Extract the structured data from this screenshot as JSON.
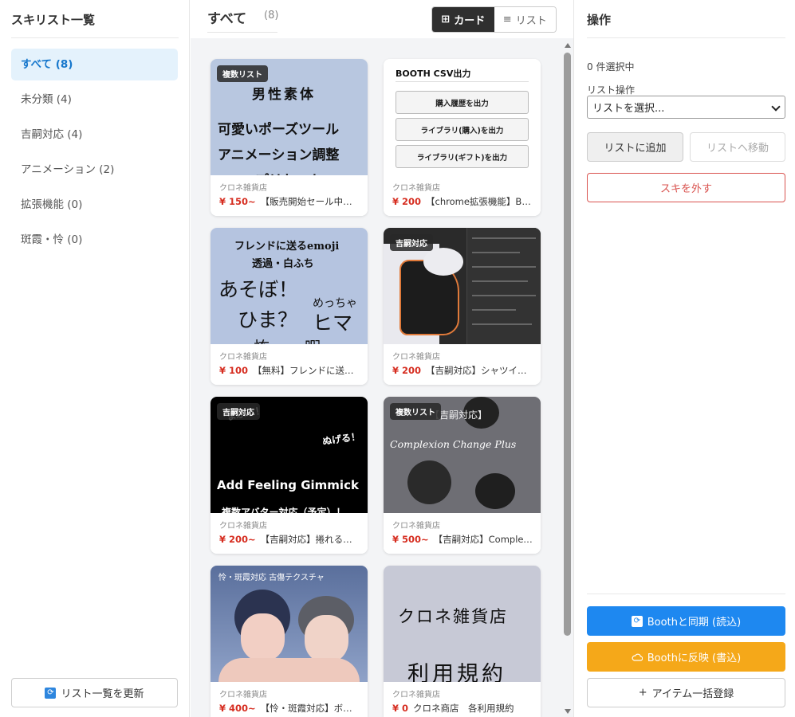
{
  "sidebar": {
    "title": "スキリスト一覧",
    "items": [
      {
        "label": "すべて (8)",
        "active": true
      },
      {
        "label": "未分類 (4)"
      },
      {
        "label": "吉嗣対応 (4)"
      },
      {
        "label": "アニメーション (2)"
      },
      {
        "label": "拡張機能 (0)"
      },
      {
        "label": "斑霞・怜 (0)"
      }
    ],
    "refresh_label": "リスト一覧を更新",
    "refresh_icon": "sync-icon"
  },
  "main": {
    "title": "すべて",
    "count": "(8)",
    "view_toggle": {
      "card": "カード",
      "list": "リスト",
      "card_glyph": "⊞",
      "list_glyph": "≡",
      "active": "card"
    },
    "cards": [
      {
        "badge": "複数リスト",
        "thumb_lines": [
          "男性素体",
          "可愛いポーズツール",
          "アニメーション調整",
          "プリセット"
        ],
        "thumb_color": "#b8c7e0",
        "shop": "クロネ雑貨店",
        "price": "¥ 150~",
        "title": "【販売開始セール中…"
      },
      {
        "badge": "",
        "thumb_heading": "BOOTH CSV出力",
        "thumb_buttons": [
          "購入履歴を出力",
          "ライブラリ(購入)を出力",
          "ライブラリ(ギフト)を出力"
        ],
        "shop": "クロネ雑貨店",
        "price": "¥ 200",
        "title": "【chrome拡張機能】Bo…"
      },
      {
        "badge": "",
        "thumb_lines": [
          "フレンドに送るemoji",
          "透過・白ふち",
          "あそぼ！",
          "めっちゃ",
          "ひま？",
          "ヒマ",
          "怖",
          "暇"
        ],
        "thumb_color": "#b5c4e0",
        "shop": "クロネ雑貨店",
        "price": "¥ 100",
        "title": "【無料】フレンドに送…"
      },
      {
        "badge": "吉嗣対応",
        "thumb_color": "#2a2a2a",
        "shop": "クロネ雑貨店",
        "price": "¥ 200",
        "title": "【吉嗣対応】シャツイ…"
      },
      {
        "badge": "吉嗣対応",
        "thumb_lines": [
          "まぶっ！",
          "ぬげる！",
          "Add Feeling Gimmick",
          "複数アバター対応（予定）！"
        ],
        "thumb_color": "#000000",
        "shop": "クロネ雑貨店",
        "price": "¥ 200~",
        "title": "【吉嗣対応】捲れる…"
      },
      {
        "badge": "複数リスト",
        "thumb_lines": [
          "【吉嗣対応】",
          "Complexion Change Plus"
        ],
        "thumb_color": "#6e6e74",
        "shop": "クロネ雑貨店",
        "price": "¥ 500~",
        "title": "【吉嗣対応】Complex…"
      },
      {
        "badge": "",
        "thumb_lines": [
          "怜・斑霞対応 古傷テクスチャ"
        ],
        "thumb_color": "#7d8fb5",
        "shop": "クロネ雑貨店",
        "price": "¥ 400~",
        "title": "【怜・斑霞対応】ボデ…"
      },
      {
        "badge": "",
        "thumb_lines": [
          "クロネ雑貨店",
          "利用規約"
        ],
        "thumb_color": "#c7c9d6",
        "shop": "クロネ雑貨店",
        "price": "¥ 0",
        "title": "クロネ商店　各利用規約"
      }
    ]
  },
  "panel": {
    "title": "操作",
    "selected_count": "0 件選択中",
    "list_op_label": "リスト操作",
    "select_placeholder": "リストを選択...",
    "add_label": "リストに追加",
    "move_label": "リストへ移動",
    "unlike_label": "スキを外す",
    "sync_label": "Boothと同期 (読込)",
    "sync_icon": "sync-icon",
    "reflect_label": "Boothに反映 (書込)",
    "reflect_icon": "cloud-upload-icon",
    "bulk_label": "アイテム一括登録",
    "bulk_glyph": "+",
    "colors": {
      "primary": "#1e88f0",
      "warning": "#f5a819",
      "danger": "#d9534f",
      "price": "#d62d20",
      "active_bg": "#e4f2fc"
    }
  }
}
